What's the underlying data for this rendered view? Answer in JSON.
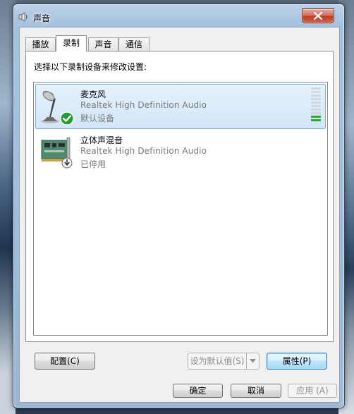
{
  "window": {
    "title": "声音",
    "close_icon": "close-x-icon"
  },
  "tabs": [
    {
      "label": "播放",
      "active": false
    },
    {
      "label": "录制",
      "active": true
    },
    {
      "label": "声音",
      "active": false
    },
    {
      "label": "通信",
      "active": false
    }
  ],
  "panel": {
    "instruction": "选择以下录制设备来修改设置:"
  },
  "devices": [
    {
      "name": "麦克风",
      "driver": "Realtek High Definition Audio",
      "status": "默认设备",
      "icon": "microphone-icon",
      "badge": "default-check-icon",
      "selected": true,
      "level_fraction": 0.17
    },
    {
      "name": "立体声混音",
      "driver": "Realtek High Definition Audio",
      "status": "已停用",
      "icon": "sound-card-icon",
      "badge": "disabled-down-arrow-icon",
      "selected": false
    }
  ],
  "buttons": {
    "configure": "配置(C)",
    "set_default": "设为默认值(S)",
    "properties": "属性(P)",
    "ok": "确定",
    "cancel": "取消",
    "apply": "应用 (A)"
  },
  "colors": {
    "selection_fill": "#d1e6f9",
    "selection_border": "#84acdd",
    "level_on": "#2fa92f",
    "level_off": "#cfd9df",
    "check_badge": "#1f9e2c"
  }
}
